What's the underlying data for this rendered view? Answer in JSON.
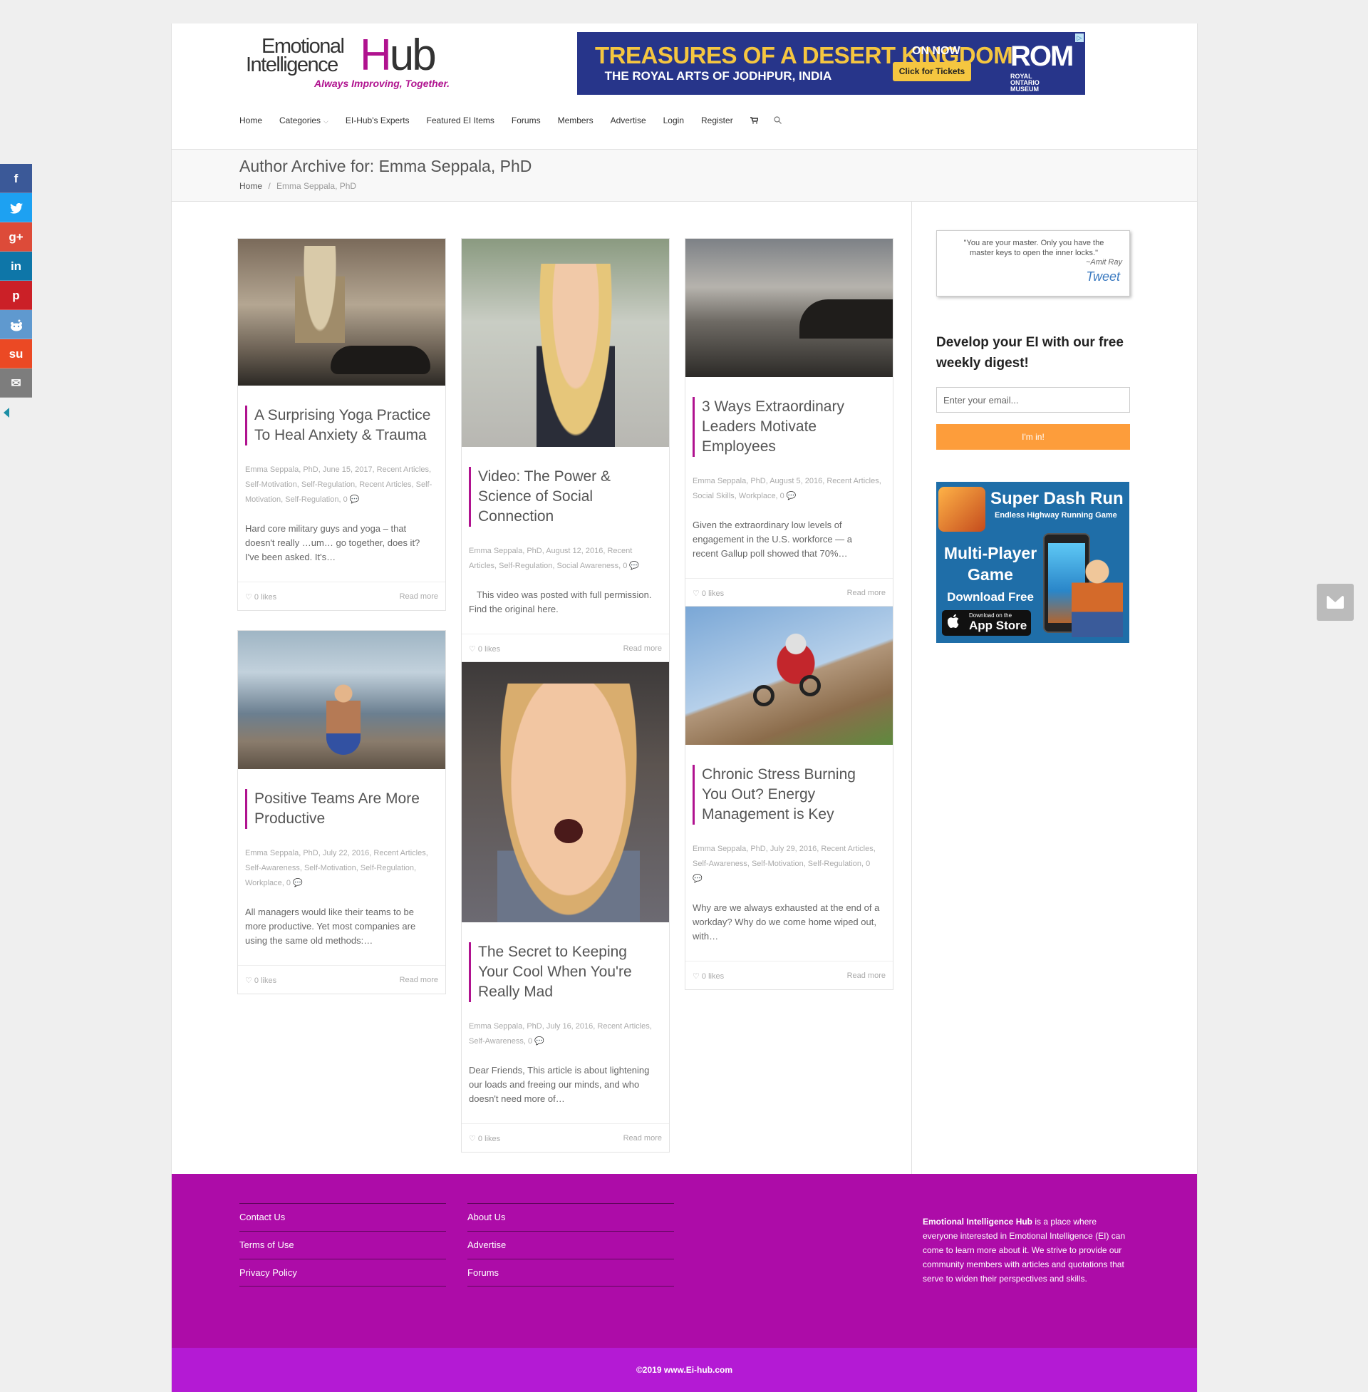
{
  "logo": {
    "line1": "Emotional",
    "line2": "Intelligence",
    "hub_h": "H",
    "hub_rest": "ub",
    "tagline": "Always Improving, Together."
  },
  "ad_banner": {
    "headline": "TREASURES OF A DESERT KINGDOM",
    "subline": "THE ROYAL ARTS OF JODHPUR, INDIA",
    "on_now": "ON NOW",
    "cta": "Click for Tickets",
    "brand": "ROM",
    "brand_sub": "ROYAL ONTARIO MUSEUM",
    "adchoices": "▷"
  },
  "nav": {
    "items": [
      "Home",
      "Categories",
      "EI-Hub's Experts",
      "Featured EI Items",
      "Forums",
      "Members",
      "Advertise",
      "Login",
      "Register"
    ],
    "cart_icon": "🛒",
    "search_icon": "⌕"
  },
  "page": {
    "title": "Author Archive for: Emma Seppala, PhD",
    "breadcrumb_home": "Home",
    "breadcrumb_sep": "/",
    "breadcrumb_current": "Emma Seppala, PhD"
  },
  "posts": [
    {
      "title": "A Surprising Yoga Practice To Heal Anxiety & Trauma",
      "meta": "Emma Seppala, PhD, June 15, 2017, Recent Articles, Self-Motivation, Self-Regulation, Recent Articles, Self-Motivation, Self-Regulation, 0 💬",
      "excerpt": "Hard core military guys and yoga – that doesn't really …um… go together, does it? I've been asked. It's…",
      "likes": "♡ 0 likes",
      "more": "Read more"
    },
    {
      "title": "Video: The Power & Science of Social Connection",
      "meta": "Emma Seppala, PhD, August 12, 2016, Recent Articles, Self-Regulation, Social Awareness, 0 💬",
      "excerpt": "   This video was posted with full permission. Find the original here.",
      "likes": "♡ 0 likes",
      "more": "Read more"
    },
    {
      "title": "3 Ways Extraordinary Leaders Motivate Employees",
      "meta": "Emma Seppala, PhD, August 5, 2016, Recent Articles, Social Skills, Workplace, 0 💬",
      "excerpt": "Given the extraordinary low levels of engagement in the U.S. workforce — a recent Gallup poll showed that 70%…",
      "likes": "♡ 0 likes",
      "more": "Read more"
    },
    {
      "title": "Positive Teams Are More Productive",
      "meta": "Emma Seppala, PhD, July 22, 2016, Recent Articles, Self-Awareness, Self-Motivation, Self-Regulation, Workplace, 0 💬",
      "excerpt": "All managers would like their teams to be more productive. Yet most companies are using the same old methods:…",
      "likes": "♡ 0 likes",
      "more": "Read more"
    },
    {
      "title": "The Secret to Keeping Your Cool When You're Really Mad",
      "meta": "Emma Seppala, PhD, July 16, 2016, Recent Articles, Self-Awareness, 0 💬",
      "excerpt": "Dear Friends, This article is about lightening our loads and freeing our minds, and who doesn't need more of…",
      "likes": "♡ 0 likes",
      "more": "Read more"
    },
    {
      "title": "Chronic Stress Burning You Out? Energy Management is Key",
      "meta": "Emma Seppala, PhD, July 29, 2016, Recent Articles, Self-Awareness, Self-Motivation, Self-Regulation, 0 💬",
      "excerpt": "Why are we always exhausted at the end of a workday? Why do we come home wiped out, with…",
      "likes": "♡ 0 likes",
      "more": "Read more"
    }
  ],
  "sidebar": {
    "quote": "\"You are your master. Only you have the master keys to open the inner locks.\"",
    "quote_author": "~Amit Ray",
    "tweet": "Tweet",
    "digest_title": "Develop your EI with our free weekly digest!",
    "email_placeholder": "Enter your email...",
    "submit": "I'm in!",
    "app_ad": {
      "name": "Super Dash Run",
      "sub": "Endless Highway Running Game",
      "mp": "Multi-Player Game",
      "download": "Download Free",
      "store_small": "Download on the",
      "store_big": "App Store",
      "apple": ""
    }
  },
  "footer": {
    "col1": [
      "Contact Us",
      "Terms of Use",
      "Privacy Policy"
    ],
    "col2": [
      "About Us",
      "Advertise",
      "Forums"
    ],
    "about_bold": "Emotional Intelligence Hub",
    "about_text": " is a place where everyone interested in Emotional Intelligence (EI) can come to learn more about it. We strive to provide our community members with articles and quotations that serve to widen their perspectives and skills.",
    "copyright": "©2019 www.Ei-hub.com"
  },
  "share": {
    "items": [
      {
        "icon": "f",
        "color": "#3b5998"
      },
      {
        "icon": "t",
        "color": "#1da1f2"
      },
      {
        "icon": "g+",
        "color": "#dd4b39"
      },
      {
        "icon": "in",
        "color": "#0e76a8"
      },
      {
        "icon": "p",
        "color": "#cb2027"
      },
      {
        "icon": "r",
        "color": "#5f99cf"
      },
      {
        "icon": "su",
        "color": "#eb4924"
      },
      {
        "icon": "✉",
        "color": "#7d7d7d"
      }
    ]
  },
  "colors": {
    "accent": "#b0128f",
    "footer": "#ad0ca8",
    "footer_bottom": "#b41ad4",
    "button": "#fd9d3b"
  }
}
